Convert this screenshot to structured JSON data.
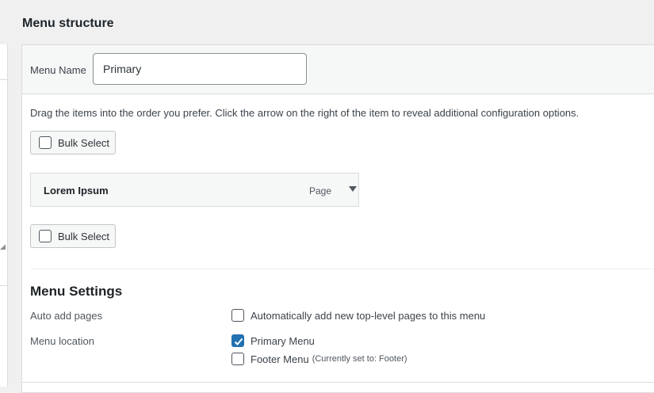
{
  "header": {
    "title": "Menu structure"
  },
  "menu_name": {
    "label": "Menu Name",
    "value": "Primary"
  },
  "instructions": "Drag the items into the order you prefer. Click the arrow on the right of the item to reveal additional configuration options.",
  "bulk_select": {
    "label": "Bulk Select",
    "checked": false
  },
  "menu_items": [
    {
      "title": "Lorem Ipsum",
      "type": "Page",
      "icon": "arrow-down-icon"
    }
  ],
  "settings": {
    "title": "Menu Settings",
    "auto_add": {
      "label": "Auto add pages",
      "option": "Automatically add new top-level pages to this menu",
      "checked": false
    },
    "location": {
      "label": "Menu location",
      "options": [
        {
          "label": "Primary Menu",
          "note": "",
          "checked": true
        },
        {
          "label": "Footer Menu",
          "note": "(Currently set to: Footer)",
          "checked": false
        }
      ]
    }
  },
  "colors": {
    "accent": "#2271b1",
    "panel_bg": "#f6f7f7",
    "page_bg": "#f0f0f1",
    "border": "#dcdcde"
  }
}
